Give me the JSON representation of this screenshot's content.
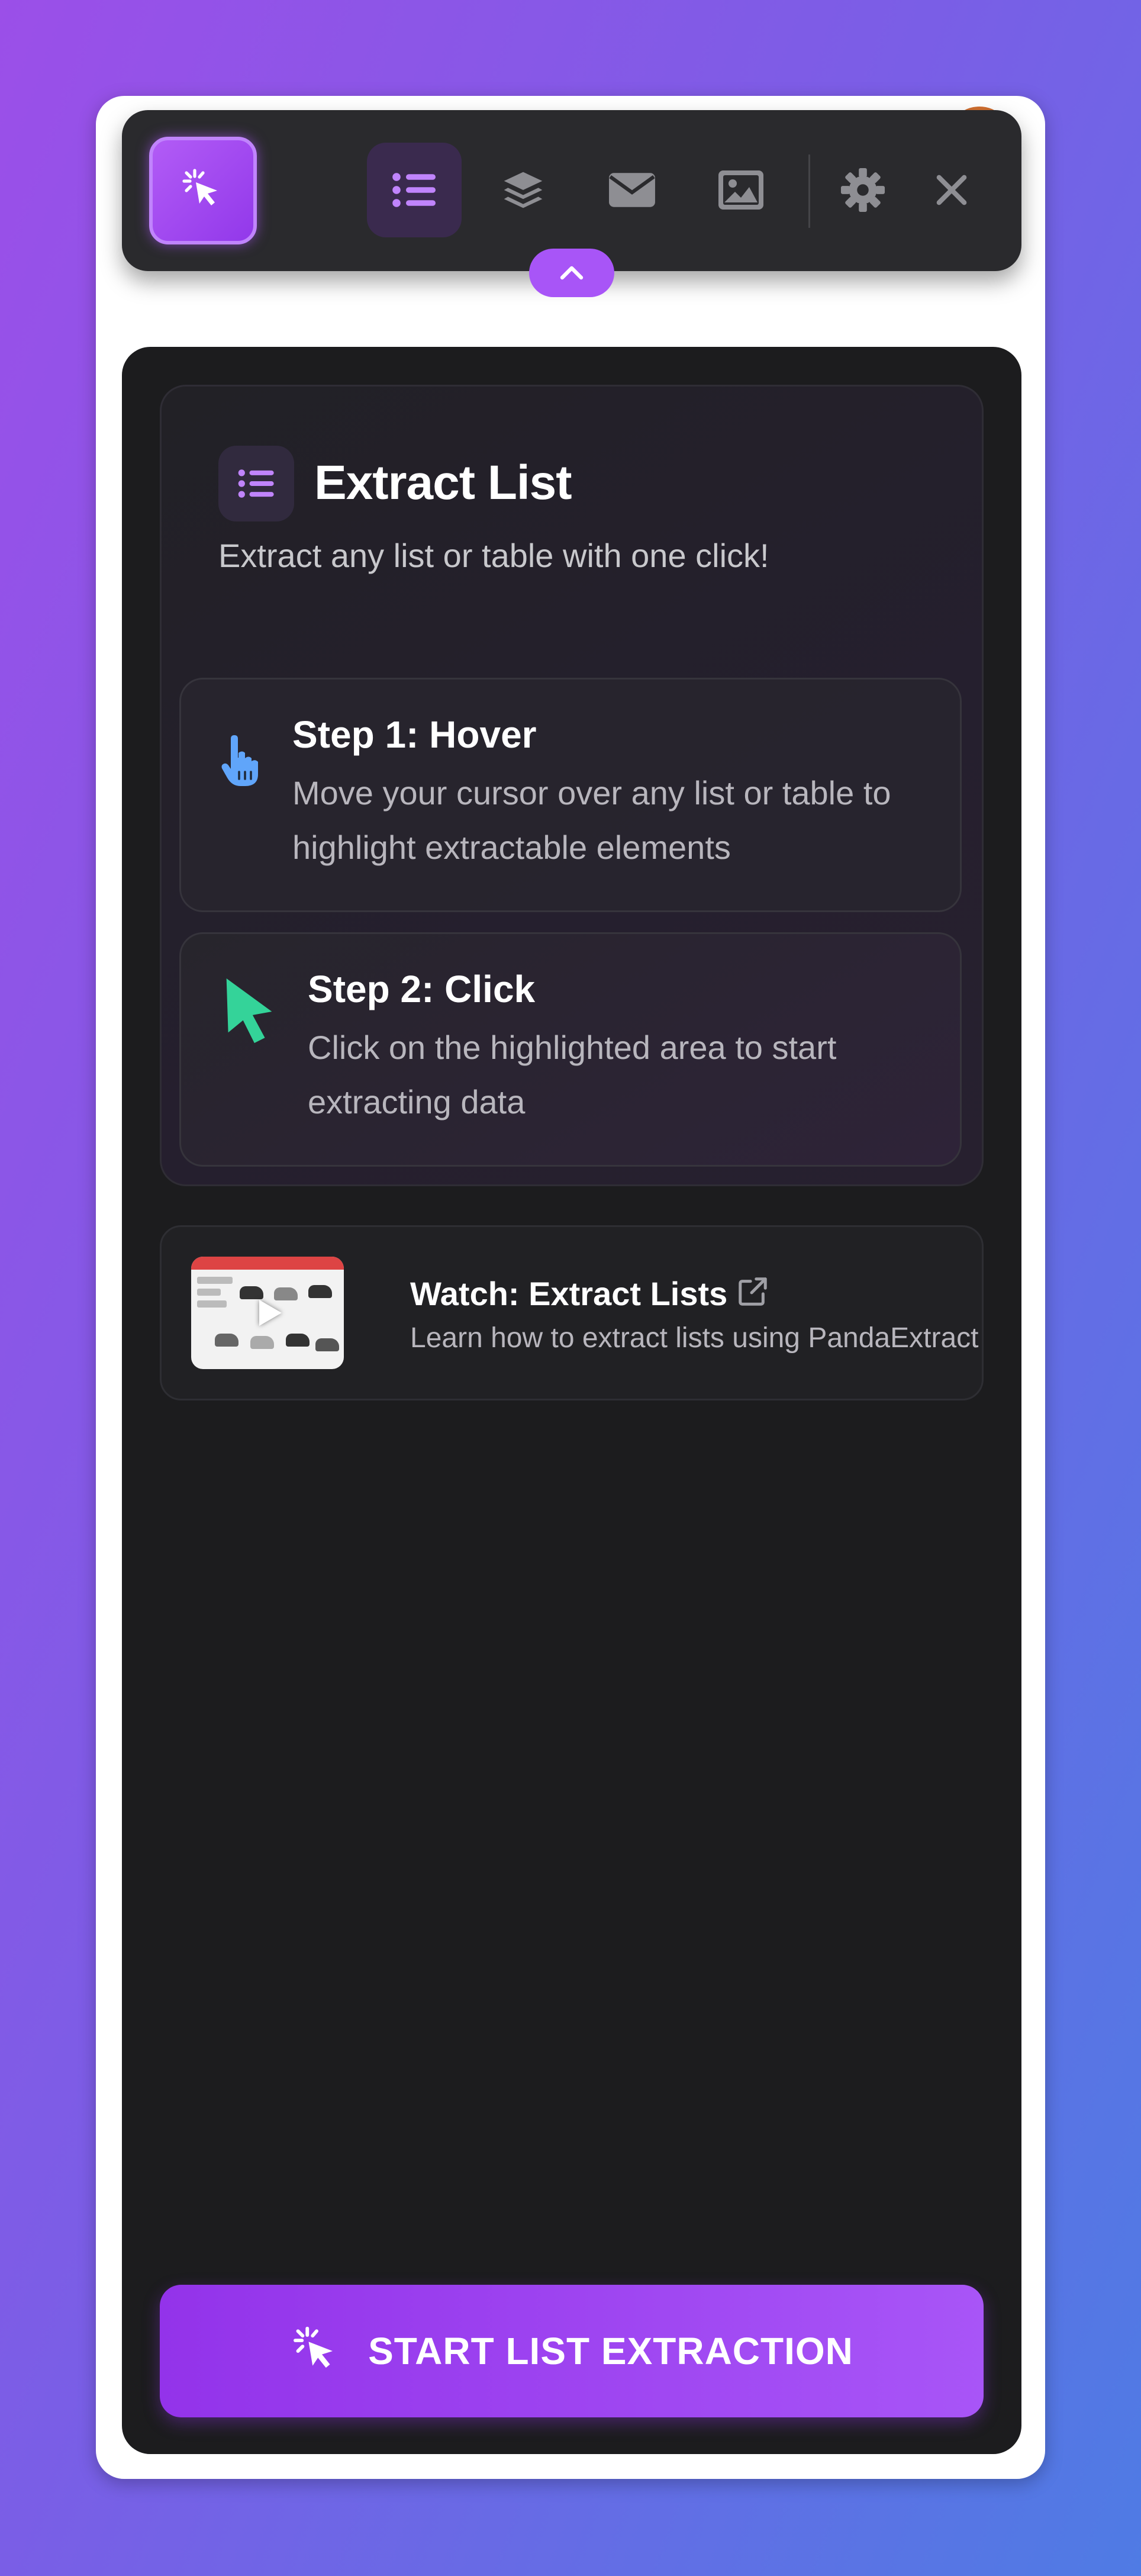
{
  "toolbar": {
    "logo_icon": "cursor-click-icon",
    "buttons": [
      {
        "icon": "list-icon",
        "active": true
      },
      {
        "icon": "layers-icon",
        "active": false
      },
      {
        "icon": "envelope-icon",
        "active": false
      },
      {
        "icon": "image-icon",
        "active": false
      },
      {
        "icon": "gear-icon",
        "active": false
      },
      {
        "icon": "close-icon",
        "active": false
      }
    ],
    "collapse_icon": "chevron-up-icon"
  },
  "panel": {
    "title": "Extract List",
    "title_icon": "list-icon",
    "subtitle": "Extract any list or table with one click!",
    "steps": [
      {
        "icon": "pointer-hand-icon",
        "title": "Step 1: Hover",
        "description": "Move your cursor over any list or table to highlight extractable elements"
      },
      {
        "icon": "cursor-arrow-icon",
        "title": "Step 2: Click",
        "description": "Click on the highlighted area to start extracting data"
      }
    ],
    "video": {
      "title": "Watch: Extract Lists",
      "description": "Learn how to extract lists using PandaExtract",
      "icon": "external-link-icon"
    },
    "start_button": {
      "label": "START LIST EXTRACTION",
      "icon": "cursor-click-icon"
    }
  },
  "colors": {
    "accent": "#a855f7",
    "panel_bg": "#1c1c1e",
    "step1_icon": "#60a5fa",
    "step2_icon": "#34d399"
  }
}
